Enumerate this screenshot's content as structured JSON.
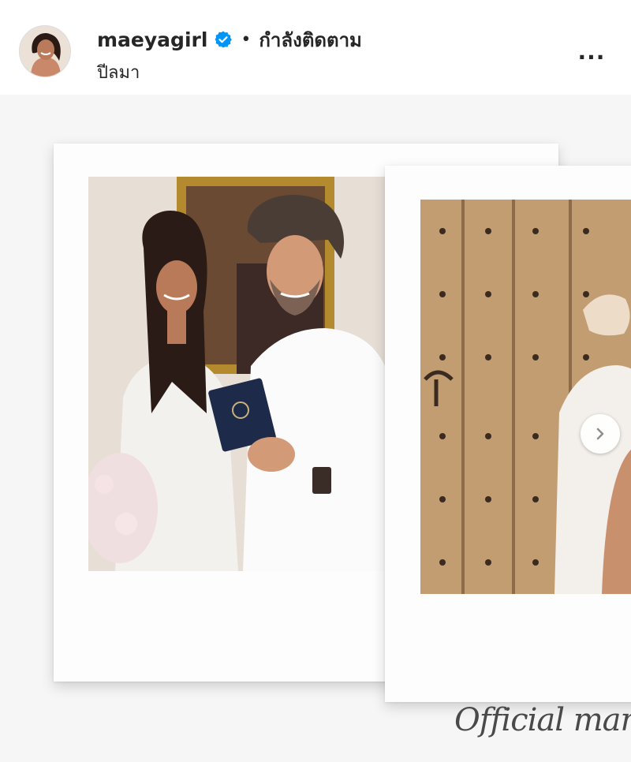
{
  "header": {
    "username": "maeyagirl",
    "verified_icon": "verified-badge-icon",
    "separator": "•",
    "follow_status": "กำลังติดตาม",
    "location": "ปีลมา",
    "more_icon": "more-options-icon",
    "more_label": "..."
  },
  "post": {
    "photo_1": "polaroid photo of a smiling couple in white holding a passport",
    "photo_2": "polaroid photo of a couple in front of a wooden door",
    "next_icon": "chevron-right-icon",
    "script_text": "Official marri"
  },
  "colors": {
    "verified_blue": "#0095f6",
    "text": "#262626"
  }
}
